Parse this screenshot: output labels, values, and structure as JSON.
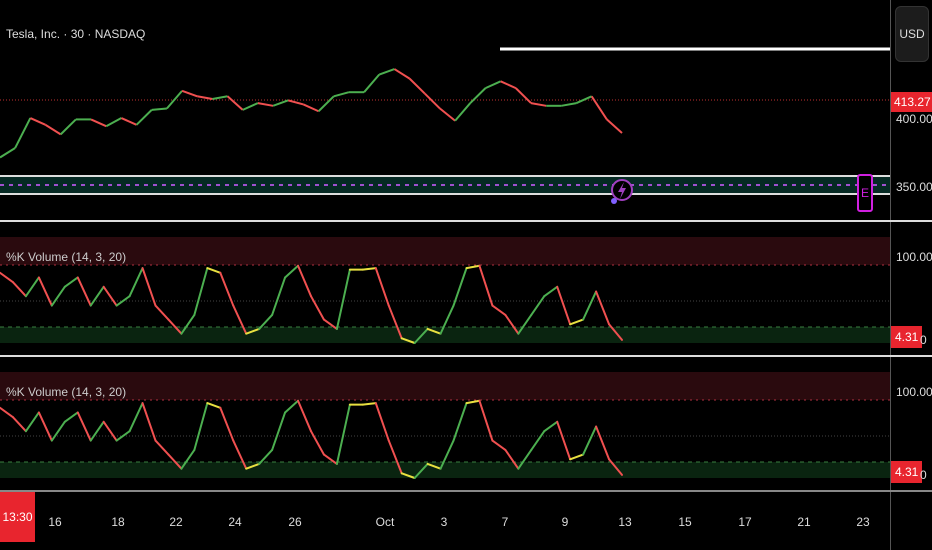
{
  "header": {
    "title": "Tesla, Inc. · 30 · NASDAQ",
    "currency": "USD"
  },
  "price_axis": {
    "last_price": "413.27",
    "labels": [
      "400.00",
      "350.00"
    ]
  },
  "events": {
    "earnings_marker": "E",
    "dividend_icon": "lightning-icon"
  },
  "oscillators": [
    {
      "title": "%K Volume (14, 3, 20)",
      "upper_label": "100.00",
      "lower_label": "0",
      "current": "4.31"
    },
    {
      "title": "%K Volume (14, 3, 20)",
      "upper_label": "100.00",
      "lower_label": "0",
      "current": "4.31"
    }
  ],
  "x_axis": {
    "cursor_time": "13:30",
    "labels": [
      "16",
      "18",
      "22",
      "24",
      "26",
      "Oct",
      "3",
      "7",
      "9",
      "13",
      "15",
      "17",
      "21",
      "23"
    ]
  },
  "colors": {
    "up": "#4caf50",
    "down": "#f05050",
    "neutral": "#e8e040",
    "badge": "#e8252e",
    "purple": "#c040e0"
  },
  "chart_data": {
    "type": "line",
    "price_series": [
      371,
      378,
      400,
      395,
      388,
      399,
      399,
      394,
      400,
      395,
      406,
      407,
      420,
      416,
      414,
      416,
      406,
      411,
      409,
      413,
      410,
      405,
      416,
      419,
      419,
      432,
      436,
      429,
      418,
      407,
      398,
      411,
      422,
      427,
      422,
      411,
      409,
      409,
      411,
      416,
      399,
      389
    ],
    "oscillator_values": [
      90,
      78,
      60,
      84,
      48,
      72,
      84,
      48,
      72,
      48,
      60,
      96,
      48,
      30,
      12,
      36,
      96,
      90,
      48,
      12,
      18,
      36,
      84,
      99,
      60,
      30,
      18,
      94,
      94,
      96,
      48,
      6,
      0,
      18,
      12,
      48,
      96,
      99,
      48,
      36,
      12,
      36,
      60,
      72,
      24,
      30,
      66,
      24,
      4
    ],
    "oscillator_range": [
      0,
      100
    ]
  }
}
